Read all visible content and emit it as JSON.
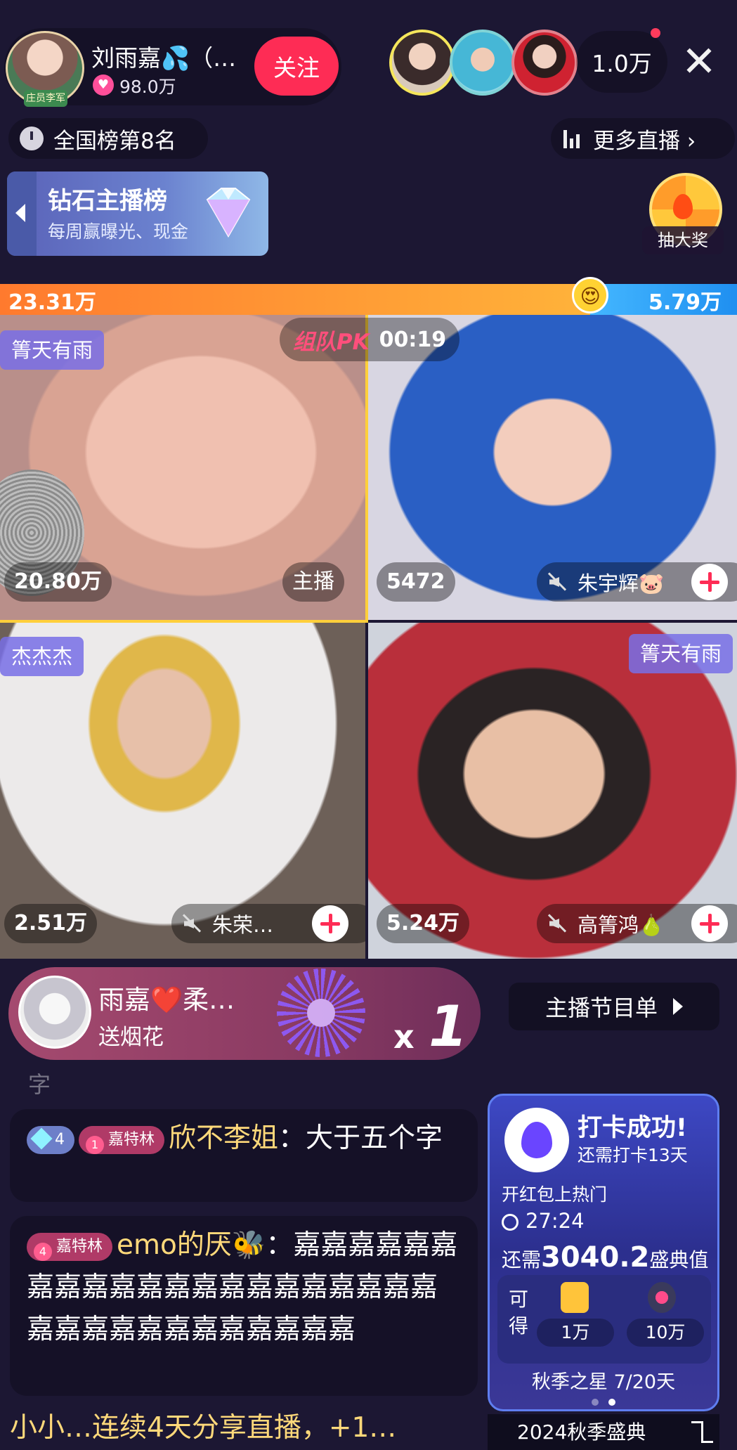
{
  "header": {
    "host_name": "刘雨嘉💦（…",
    "host_badge": "庄员李军",
    "host_hearts": "98.0万",
    "follow_label": "关注",
    "viewer_count": "1.0万",
    "close_glyph": "✕"
  },
  "rank": {
    "label": "全国榜第8名"
  },
  "more_live": {
    "label": "更多直播 ›"
  },
  "diamond_banner": {
    "title": "钻石主播榜",
    "subtitle": "每周赢曝光、现金"
  },
  "lottery": {
    "label": "抽大奖"
  },
  "pk": {
    "left_score": "23.31万",
    "right_score": "5.79万",
    "left_share": 0.801,
    "logo": "组队PK",
    "timer": "00:19",
    "emoji": "😍",
    "left_color": "#ff9a30",
    "right_color": "#2f9ff6"
  },
  "cells": [
    {
      "tag": "箐天有雨",
      "score": "20.80万",
      "role": "主播"
    },
    {
      "score": "5472",
      "user": "朱宇辉🐷"
    },
    {
      "tag": "杰杰杰",
      "score": "2.51万",
      "user": "朱荣…"
    },
    {
      "tag": "箐天有雨",
      "score": "5.24万",
      "user": "高箐鸿🍐"
    }
  ],
  "gift": {
    "sender": "雨嘉❤️柔…",
    "action": "送烟花",
    "x": "x",
    "count": "1"
  },
  "program_list": {
    "label": "主播节目单"
  },
  "stray_char": "字",
  "chat": [
    {
      "level": "4",
      "fan_level": "1",
      "fan_club": "嘉特林",
      "nick": "欣不李姐",
      "text": "：大于五个字"
    },
    {
      "fan_level": "4",
      "fan_club": "嘉特林",
      "nick": "emo的厌🐝",
      "text": "：嘉嘉嘉嘉嘉嘉嘉嘉嘉嘉嘉嘉嘉嘉嘉嘉嘉嘉嘉嘉嘉嘉嘉嘉嘉嘉嘉嘉嘉嘉嘉嘉嘉"
    },
    {
      "text": "小小…连续4天分享直播，+1…"
    }
  ],
  "checkin": {
    "title": "打卡成功!",
    "subtitle": "还需打卡13天",
    "red_packet": "开红包上热门",
    "timer": "27:24",
    "need_prefix": "还需",
    "need_value": "3040.2",
    "need_suffix": "盛典值",
    "reward_label": "可得",
    "reward_1": "1万",
    "reward_2": "10万",
    "progress": "秋季之星 7/20天",
    "festival": "2024秋季盛典"
  }
}
